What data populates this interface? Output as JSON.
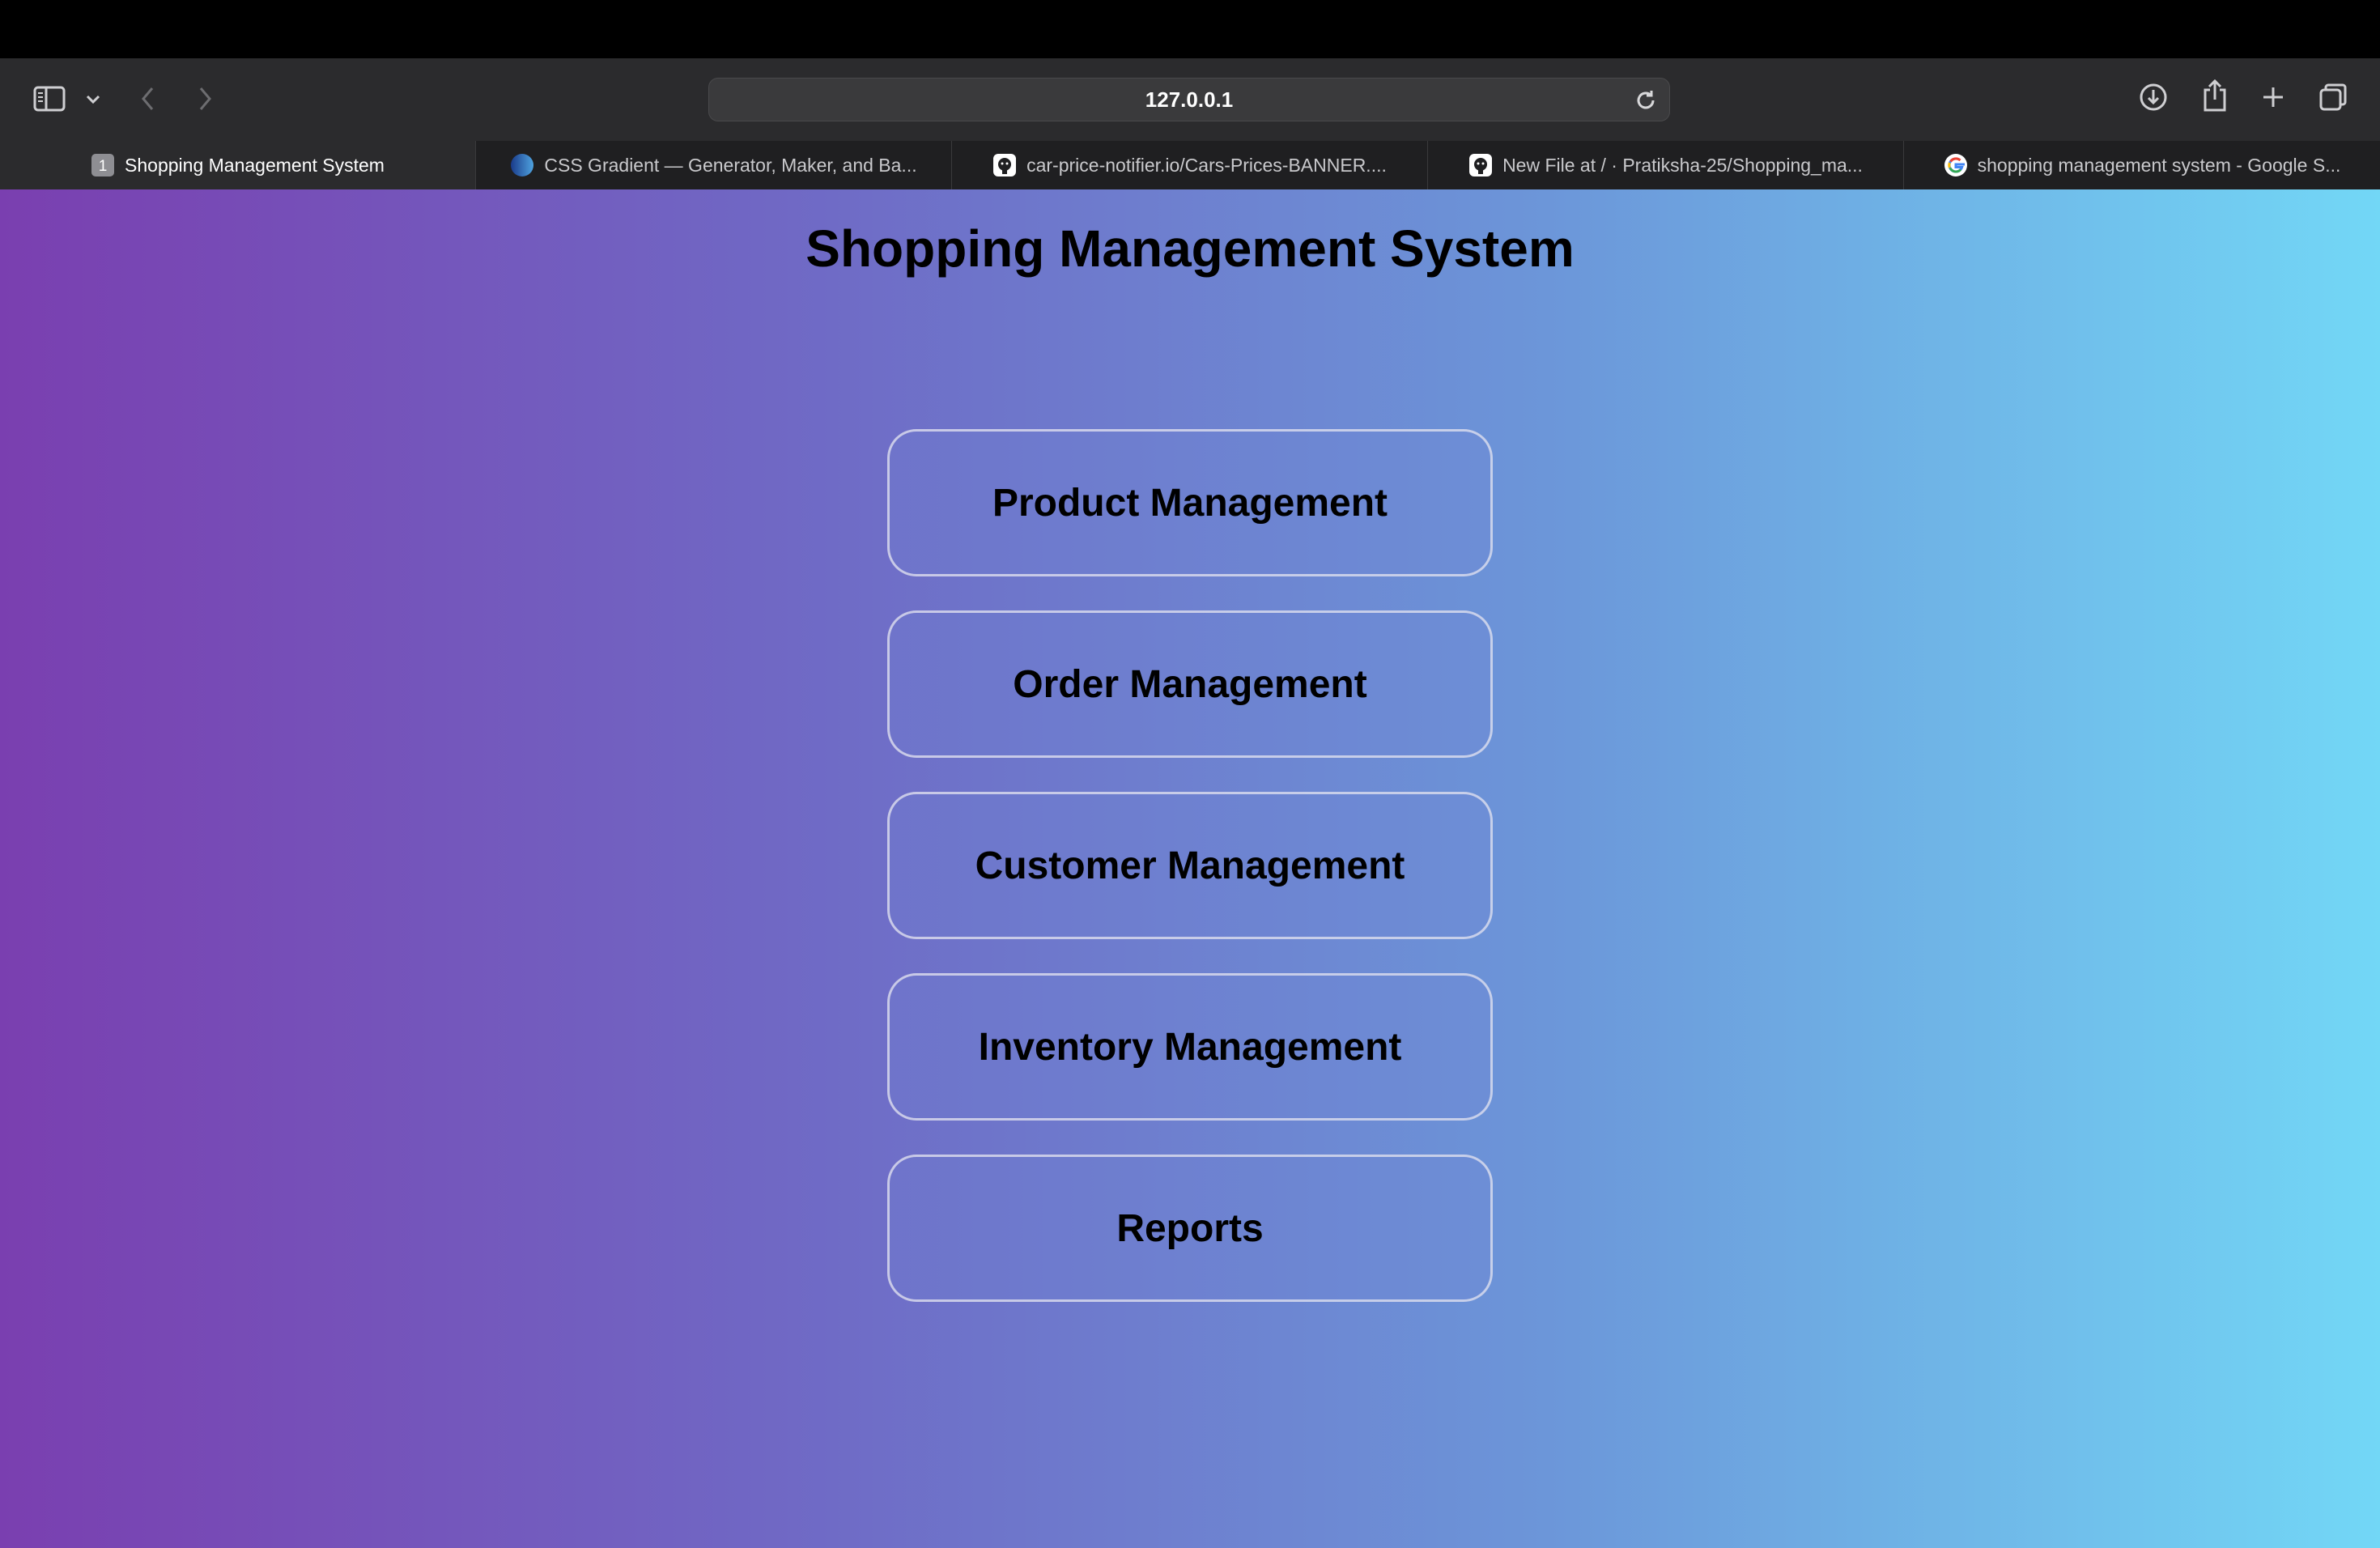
{
  "browser": {
    "address": "127.0.0.1",
    "tabs": [
      {
        "label": "Shopping Management System",
        "favicon": "number-badge-icon",
        "badge": "1",
        "active": true
      },
      {
        "label": "CSS Gradient — Generator, Maker, and Ba...",
        "favicon": "gradient-circle-icon",
        "active": false
      },
      {
        "label": "car-price-notifier.io/Cars-Prices-BANNER....",
        "favicon": "github-icon",
        "active": false
      },
      {
        "label": "New File at / · Pratiksha-25/Shopping_ma...",
        "favicon": "github-icon",
        "active": false
      },
      {
        "label": "shopping management system - Google S...",
        "favicon": "google-icon",
        "active": false
      }
    ]
  },
  "page": {
    "title": "Shopping Management System",
    "menu": [
      {
        "label": "Product Management"
      },
      {
        "label": "Order Management"
      },
      {
        "label": "Customer Management"
      },
      {
        "label": "Inventory Management"
      },
      {
        "label": "Reports"
      }
    ],
    "gradient_colors": [
      "#7a3fb0",
      "#6f6bc6",
      "#6c96d9",
      "#72d7f6"
    ]
  }
}
